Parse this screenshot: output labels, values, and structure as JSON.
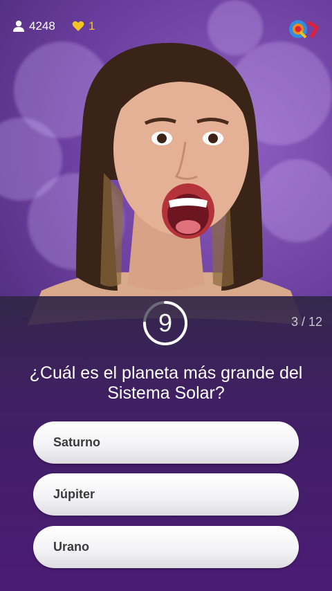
{
  "header": {
    "viewers_icon": "user-icon",
    "viewers_count": "4248",
    "lives_icon": "heart-icon",
    "lives_count": "1",
    "logo_icon": "q-logo-icon"
  },
  "question_panel": {
    "timer_seconds": "9",
    "timer_remaining_fraction": 0.75,
    "counter": "3 / 12",
    "question": "¿Cuál es el planeta más grande del Sistema Solar?",
    "answers": [
      {
        "label": "Saturno"
      },
      {
        "label": "Júpiter"
      },
      {
        "label": "Urano"
      }
    ]
  },
  "colors": {
    "background_purple": "#6a3e9e",
    "lives_yellow": "#f4c521",
    "answer_bg": "#ffffff",
    "answer_text": "#3a3a3a",
    "timer_ring": "#ffffff",
    "timer_track": "#6d6a78"
  }
}
